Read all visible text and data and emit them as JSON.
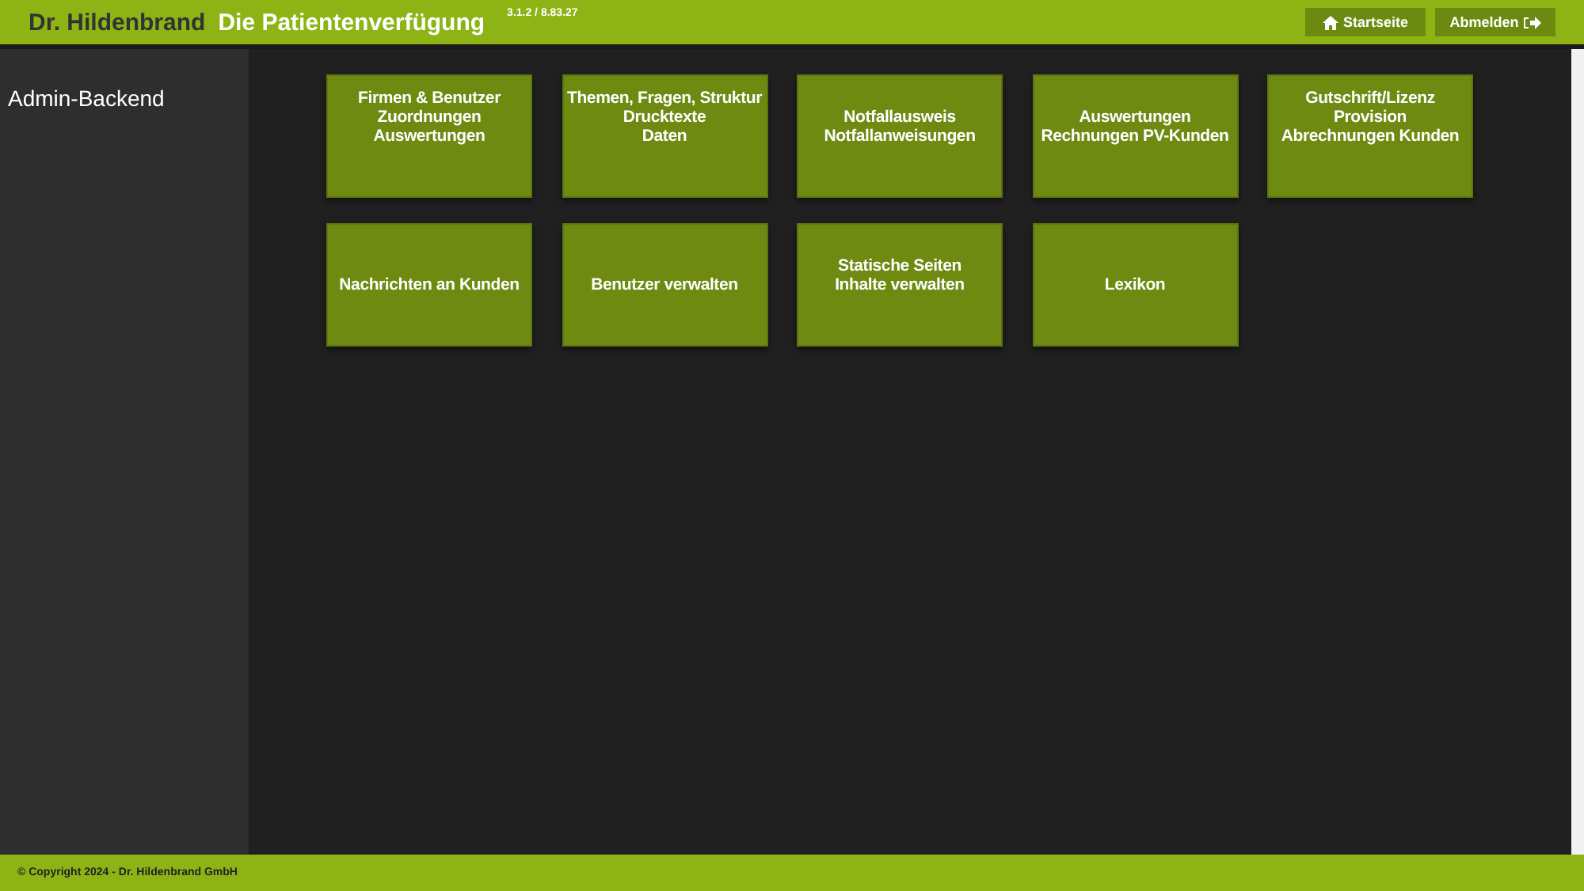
{
  "header": {
    "brand": "Dr. Hildenbrand",
    "title": "Die Patientenverfügung",
    "version": "3.1.2 / 8.83.27",
    "buttons": [
      {
        "kind": "home",
        "label": "Startseite"
      },
      {
        "kind": "logout",
        "label": "Abmelden"
      }
    ]
  },
  "sidebar": {
    "title": "Admin-Backend"
  },
  "tiles": [
    {
      "label": "Firmen & Benutzer\nZuordnungen\nAuswertungen"
    },
    {
      "label": "Themen, Fragen, Struktur\nDrucktexte\nDaten"
    },
    {
      "label": "Notfallausweis\nNotfallanweisungen"
    },
    {
      "label": "Auswertungen\nRechnungen PV-Kunden"
    },
    {
      "label": "Gutschrift/Lizenz\nProvision\nAbrechnungen Kunden"
    },
    {
      "label": "Nachrichten an Kunden"
    },
    {
      "label": "Benutzer verwalten"
    },
    {
      "label": "Statische Seiten\nInhalte verwalten"
    },
    {
      "label": "Lexikon"
    }
  ],
  "footer": {
    "copyright": "© Copyright 2024 - Dr. Hildenbrand GmbH"
  }
}
